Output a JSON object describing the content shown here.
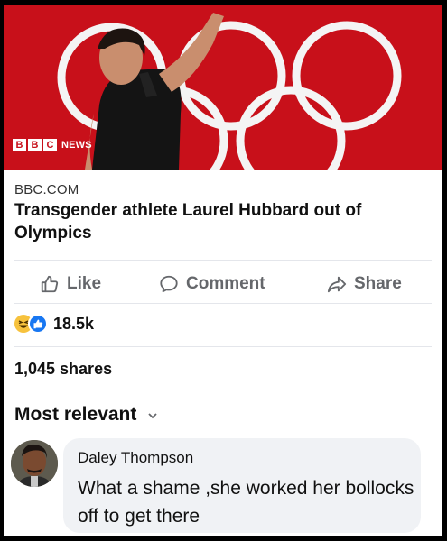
{
  "post": {
    "image": {
      "logo_letters": [
        "B",
        "B",
        "C"
      ],
      "logo_suffix": "NEWS"
    },
    "link": {
      "domain": "BBC.COM",
      "title": "Transgender athlete Laurel Hubbard out of Olympics"
    },
    "actions": {
      "like": "Like",
      "comment": "Comment",
      "share": "Share"
    },
    "reactions": {
      "count": "18.5k",
      "types": [
        "laugh-reaction-icon",
        "like-reaction-icon"
      ]
    },
    "shares_label": "1,045 shares",
    "sort_label": "Most relevant",
    "comment": {
      "author": "Daley Thompson",
      "text": "What a shame ,she worked her bollocks off to get there"
    }
  },
  "colors": {
    "hero_red": "#c8101a",
    "action_gray": "#65676b",
    "bubble_bg": "#f0f2f5",
    "like_blue": "#1877f2"
  }
}
